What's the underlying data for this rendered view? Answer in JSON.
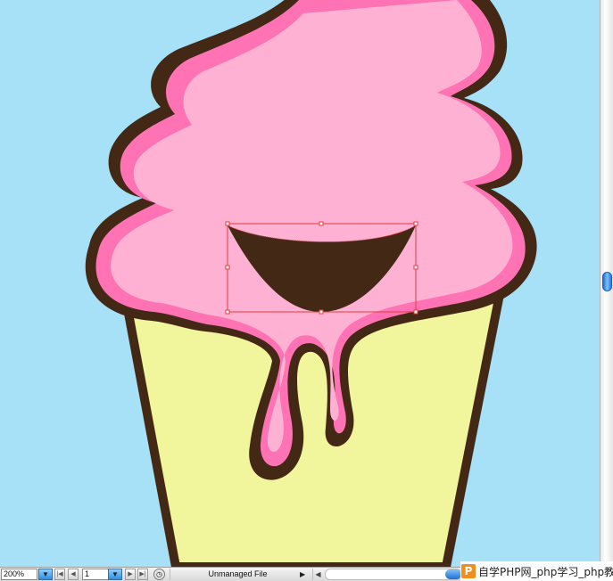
{
  "statusbar": {
    "zoom_value": "200%",
    "page_value": "1",
    "status_text": "Unmanaged File",
    "first_page_glyph": "|◀",
    "prev_page_glyph": "◀",
    "next_page_glyph": "▶",
    "last_page_glyph": "▶|",
    "dropdown_glyph": "▼",
    "status_arrow_glyph": "▶",
    "scroll_left_glyph": "◀"
  },
  "watermark": {
    "logo_letter": "P",
    "text": "自学PHP网_php学习_php教"
  },
  "colors": {
    "background": "#a6e1f8",
    "outline": "#432815",
    "icecream_pink": "#ffb1d4",
    "icecream_rim": "#ff72b3",
    "cone": "#f1f59b",
    "selection": "#e03c3c"
  }
}
